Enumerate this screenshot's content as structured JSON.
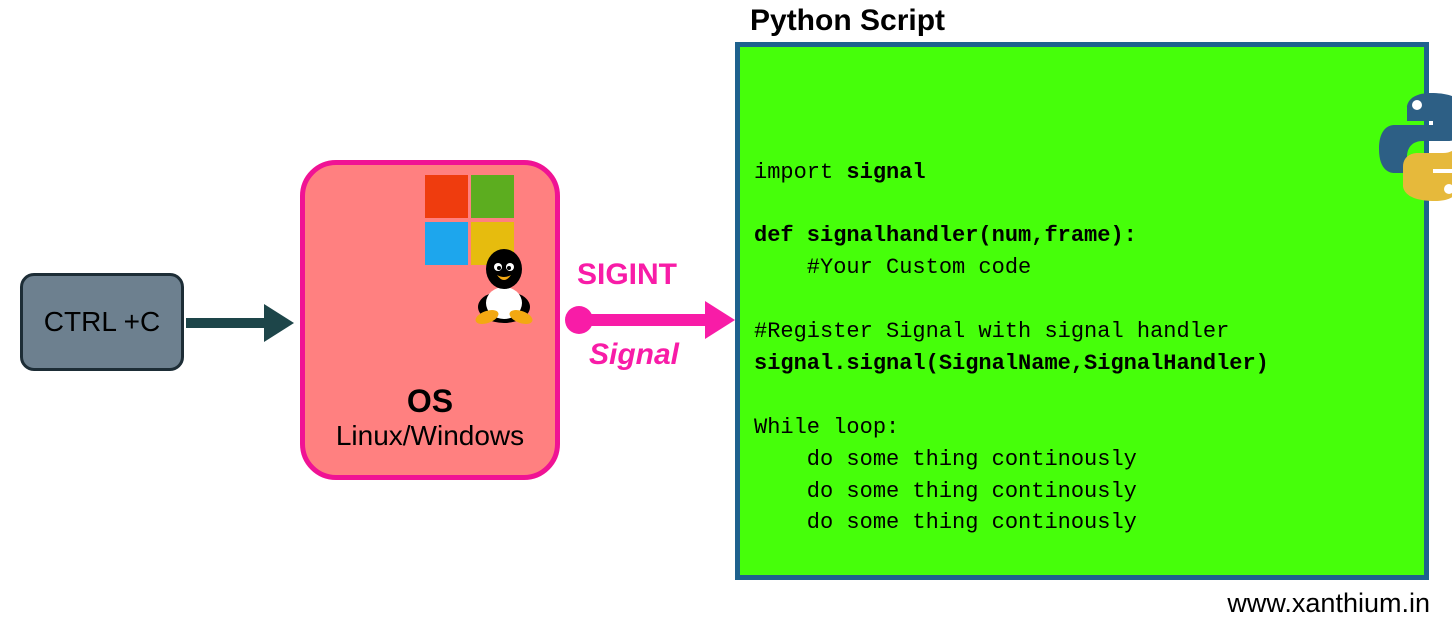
{
  "ctrl_box": {
    "label": "CTRL +C"
  },
  "arrow1": {
    "color": "#1d4549"
  },
  "os_box": {
    "title": "OS",
    "subtitle": "Linux/Windows",
    "windows_colors": {
      "tl": "#ef3c0e",
      "tr": "#5cad1f",
      "bl": "#1da6ed",
      "br": "#e6bc0e"
    }
  },
  "arrow2": {
    "top_label": "SIGINT",
    "bottom_label": "Signal",
    "color": "#f81ca7"
  },
  "script": {
    "title": "Python Script",
    "lines": [
      {
        "t": "import ",
        "b": false
      },
      {
        "t": "signal",
        "b": true
      },
      {
        "t": "\n\n"
      },
      {
        "t": "def signalhandler(num,frame):",
        "b": true
      },
      {
        "t": "\n"
      },
      {
        "t": "    #Your Custom code\n\n",
        "b": false
      },
      {
        "t": "#Register Signal with signal handler\n",
        "b": false
      },
      {
        "t": "signal.signal(SignalName,SignalHandler)",
        "b": true
      },
      {
        "t": "\n\n"
      },
      {
        "t": "While loop:\n",
        "b": false
      },
      {
        "t": "    do some thing continously\n",
        "b": false
      },
      {
        "t": "    do some thing continously\n",
        "b": false
      },
      {
        "t": "    do some thing continously",
        "b": false
      }
    ],
    "python_logo_colors": {
      "top": "#2d5f85",
      "bottom": "#e6b93b"
    }
  },
  "footer": {
    "text": "www.xanthium.in"
  }
}
